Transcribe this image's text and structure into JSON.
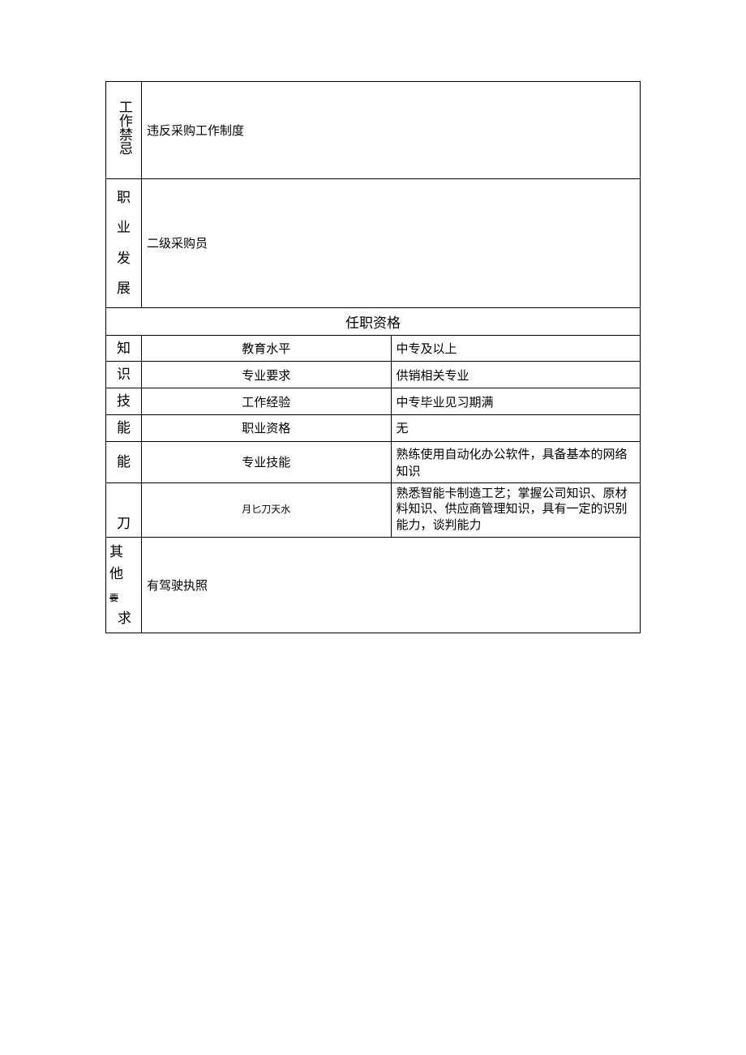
{
  "taboo": {
    "label": "工作禁忌",
    "value": "违反采购工作制度"
  },
  "career": {
    "label_1": "职",
    "label_2": "业发",
    "label_3": "展",
    "value": "二级采购员"
  },
  "section_header": "任职资格",
  "knowledge": {
    "label_1": "知",
    "label_2": "识",
    "rows": [
      {
        "sub": "教育水平",
        "val": "中专及以上"
      },
      {
        "sub": "专业要求",
        "val": "供销相关专业"
      }
    ]
  },
  "skills": {
    "label_1": "技",
    "label_2": "能",
    "label_3": "能",
    "label_4": "刀",
    "rows": [
      {
        "sub": "工作经验",
        "val": "中专毕业见习期满"
      },
      {
        "sub": "职业资格",
        "val": "无"
      },
      {
        "sub": "专业技能",
        "val": "熟练使用自动化办公软件，具备基本的网络知识"
      },
      {
        "sub": "月匕刀天水",
        "val": "熟悉智能卡制造工艺；掌握公司知识、原材料知识、供应商管理知识，具有一定的识别能力，谈判能力"
      }
    ]
  },
  "other": {
    "label_1": "其",
    "label_2": "他",
    "label_3": "要",
    "label_4": "求",
    "value": "有驾驶执照"
  }
}
